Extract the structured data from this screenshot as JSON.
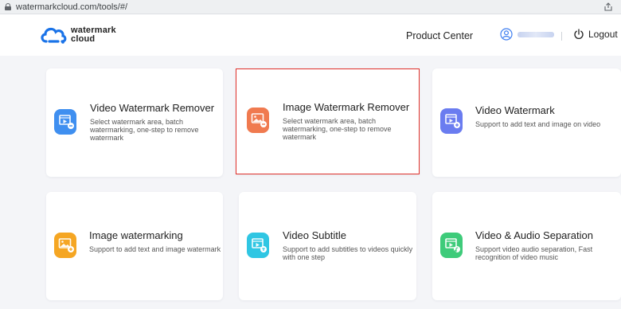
{
  "browser": {
    "url": "watermarkcloud.com/tools/#/"
  },
  "header": {
    "logo_line1": "watermark",
    "logo_line2": "cloud",
    "product_center": "Product Center",
    "logout": "Logout"
  },
  "colors": {
    "selected_border": "#e0312b",
    "blue": "#3f8ff0",
    "orange": "#f07a4f",
    "indigo": "#6a7cf0",
    "yellow": "#f5a623",
    "cyan": "#2fc6e3",
    "green": "#3ecb7a"
  },
  "tools": [
    {
      "title": "Video Watermark Remover",
      "desc": "Select watermark area, batch watermarking, one-step to remove watermark",
      "icon": "video-remove-icon",
      "color": "#3f8ff0",
      "selected": false
    },
    {
      "title": "Image Watermark Remover",
      "desc": "Select watermark area, batch watermarking, one-step to remove watermark",
      "icon": "image-remove-icon",
      "color": "#f07a4f",
      "selected": true
    },
    {
      "title": "Video Watermark",
      "desc": "Support to add text and image on video",
      "icon": "video-add-icon",
      "color": "#6a7cf0",
      "selected": false
    },
    {
      "title": "Image watermarking",
      "desc": "Support to add text and image watermark",
      "icon": "image-add-icon",
      "color": "#f5a623",
      "selected": false
    },
    {
      "title": "Video Subtitle",
      "desc": "Support to add subtitles to videos quickly with one step",
      "icon": "subtitle-icon",
      "color": "#2fc6e3",
      "selected": false
    },
    {
      "title": "Video & Audio Separation",
      "desc": "Support video audio separation, Fast recognition of video music",
      "icon": "audio-separation-icon",
      "color": "#3ecb7a",
      "selected": false
    }
  ]
}
